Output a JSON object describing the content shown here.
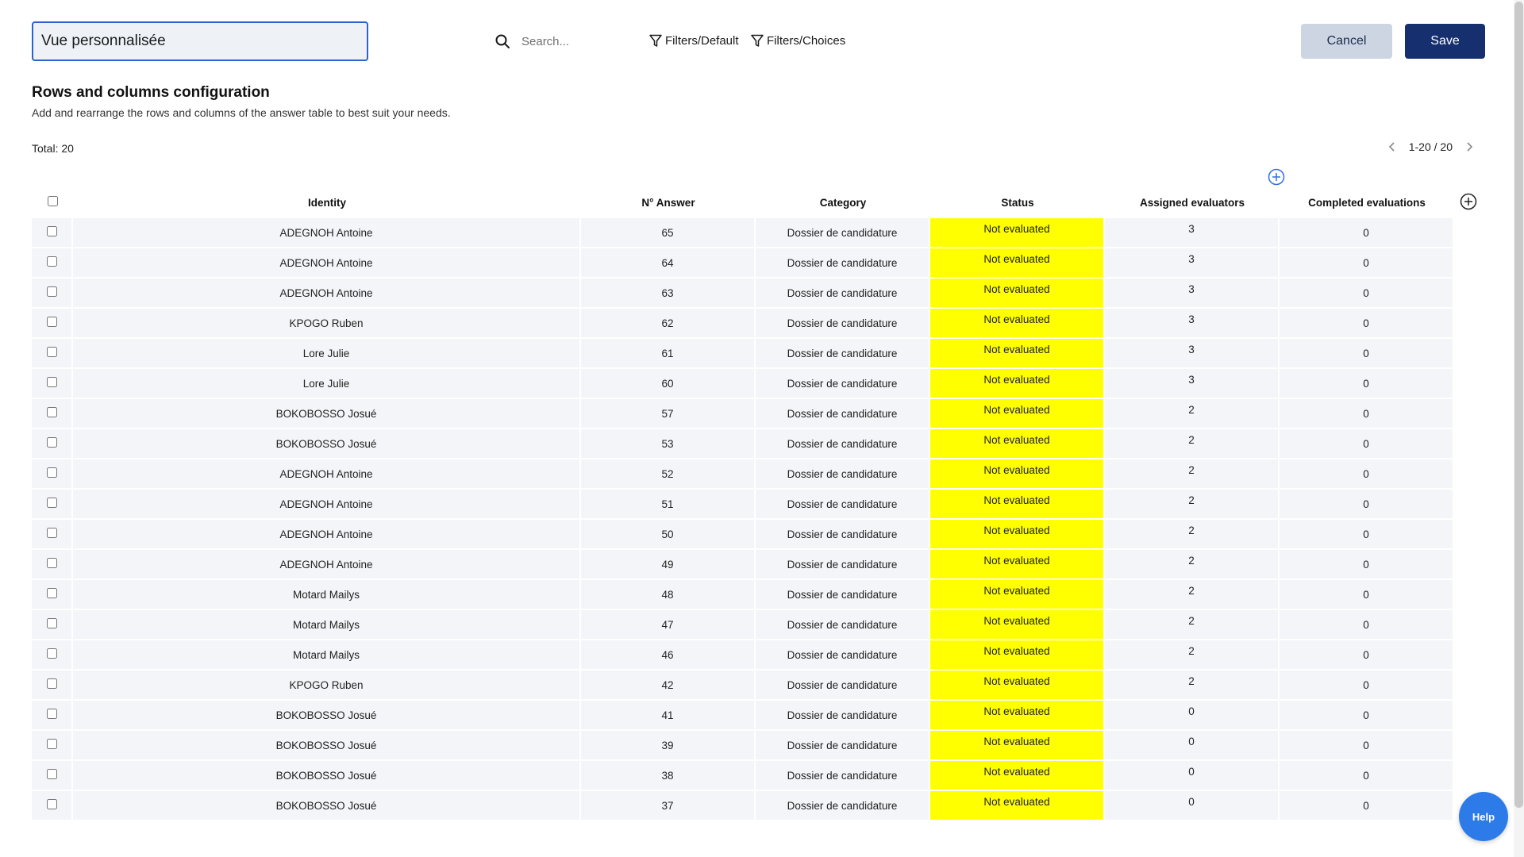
{
  "header": {
    "view_name": "Vue personnalisée",
    "search_placeholder": "Search...",
    "filter_default_label": "Filters/Default",
    "filter_choices_label": "Filters/Choices",
    "cancel_label": "Cancel",
    "save_label": "Save"
  },
  "section": {
    "title": "Rows and columns configuration",
    "description": "Add and rearrange the rows and columns of the answer table to best suit your needs."
  },
  "summary": {
    "total": "Total: 20",
    "pagination": "1-20 / 20"
  },
  "table": {
    "columns": [
      "Identity",
      "N° Answer",
      "Category",
      "Status",
      "Assigned evaluators",
      "Completed evaluations"
    ],
    "rows": [
      [
        "ADEGNOH Antoine",
        "65",
        "Dossier de candidature",
        "Not evaluated",
        "3",
        "0"
      ],
      [
        "ADEGNOH Antoine",
        "64",
        "Dossier de candidature",
        "Not evaluated",
        "3",
        "0"
      ],
      [
        "ADEGNOH Antoine",
        "63",
        "Dossier de candidature",
        "Not evaluated",
        "3",
        "0"
      ],
      [
        "KPOGO Ruben",
        "62",
        "Dossier de candidature",
        "Not evaluated",
        "3",
        "0"
      ],
      [
        "Lore Julie",
        "61",
        "Dossier de candidature",
        "Not evaluated",
        "3",
        "0"
      ],
      [
        "Lore Julie",
        "60",
        "Dossier de candidature",
        "Not evaluated",
        "3",
        "0"
      ],
      [
        "BOKOBOSSO Josué",
        "57",
        "Dossier de candidature",
        "Not evaluated",
        "2",
        "0"
      ],
      [
        "BOKOBOSSO Josué",
        "53",
        "Dossier de candidature",
        "Not evaluated",
        "2",
        "0"
      ],
      [
        "ADEGNOH Antoine",
        "52",
        "Dossier de candidature",
        "Not evaluated",
        "2",
        "0"
      ],
      [
        "ADEGNOH Antoine",
        "51",
        "Dossier de candidature",
        "Not evaluated",
        "2",
        "0"
      ],
      [
        "ADEGNOH Antoine",
        "50",
        "Dossier de candidature",
        "Not evaluated",
        "2",
        "0"
      ],
      [
        "ADEGNOH Antoine",
        "49",
        "Dossier de candidature",
        "Not evaluated",
        "2",
        "0"
      ],
      [
        "Motard Mailys",
        "48",
        "Dossier de candidature",
        "Not evaluated",
        "2",
        "0"
      ],
      [
        "Motard Mailys",
        "47",
        "Dossier de candidature",
        "Not evaluated",
        "2",
        "0"
      ],
      [
        "Motard Mailys",
        "46",
        "Dossier de candidature",
        "Not evaluated",
        "2",
        "0"
      ],
      [
        "KPOGO Ruben",
        "42",
        "Dossier de candidature",
        "Not evaluated",
        "2",
        "0"
      ],
      [
        "BOKOBOSSO Josué",
        "41",
        "Dossier de candidature",
        "Not evaluated",
        "0",
        "0"
      ],
      [
        "BOKOBOSSO Josué",
        "39",
        "Dossier de candidature",
        "Not evaluated",
        "0",
        "0"
      ],
      [
        "BOKOBOSSO Josué",
        "38",
        "Dossier de candidature",
        "Not evaluated",
        "0",
        "0"
      ],
      [
        "BOKOBOSSO Josué",
        "37",
        "Dossier de candidature",
        "Not evaluated",
        "0",
        "0"
      ]
    ]
  },
  "help_label": "Help",
  "icons": {
    "search": "search-icon",
    "filter": "filter-icon",
    "add": "plus-circle-icon",
    "prev": "chevron-left-icon",
    "next": "chevron-right-icon"
  },
  "colors": {
    "accent": "#2f5fd0",
    "save_bg": "#16306f",
    "cancel_bg": "#cdd5e3",
    "status_not_evaluated": "#ffff00",
    "help_bg": "#2d7be8"
  }
}
